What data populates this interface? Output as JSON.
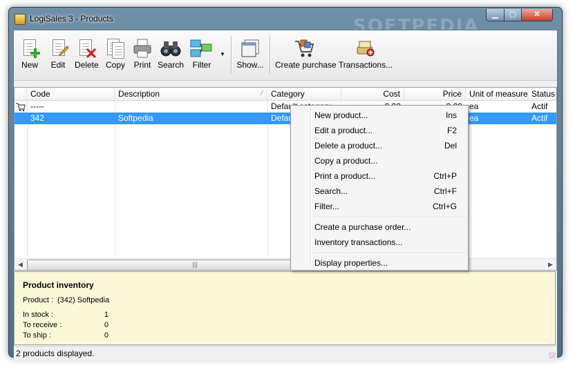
{
  "window": {
    "title": "LogiSales 3 - Products",
    "watermark": "SOFTPEDIA"
  },
  "toolbar": {
    "new": "New",
    "edit": "Edit",
    "delete": "Delete",
    "copy": "Copy",
    "print": "Print",
    "search": "Search",
    "filter": "Filter",
    "show": "Show...",
    "create_purchase": "Create purchase",
    "transactions": "Transactions..."
  },
  "grid": {
    "columns": [
      "Code",
      "Description",
      "Category",
      "Cost",
      "Price",
      "Unit of measure",
      "Status"
    ],
    "rows": [
      {
        "code": "-----",
        "description": "",
        "category": "Default category",
        "cost": "0.00",
        "price": "0.00",
        "unit": "ea",
        "status": "Actif"
      },
      {
        "code": "342",
        "description": "Softpedia",
        "category": "Defau",
        "cost": "",
        "price": "",
        "unit": "ea",
        "status": "Actif"
      }
    ]
  },
  "context_menu": {
    "items": [
      {
        "label": "New product...",
        "key": "Ins"
      },
      {
        "label": "Edit a product...",
        "key": "F2"
      },
      {
        "label": "Delete a product...",
        "key": "Del"
      },
      {
        "label": "Copy a product...",
        "key": ""
      },
      {
        "label": "Print a product...",
        "key": "Ctrl+P"
      },
      {
        "label": "Search...",
        "key": "Ctrl+F"
      },
      {
        "label": "Filter...",
        "key": "Ctrl+G"
      },
      {
        "label": "Create a purchase order...",
        "key": ""
      },
      {
        "label": "Inventory transactions...",
        "key": ""
      },
      {
        "label": "Display properties...",
        "key": ""
      }
    ]
  },
  "inventory": {
    "title": "Product inventory",
    "product_label": "Product :",
    "product_value": "(342) Softpedia",
    "in_stock_label": "In stock :",
    "in_stock_value": "1",
    "to_receive_label": "To receive :",
    "to_receive_value": "0",
    "to_ship_label": "To ship :",
    "to_ship_value": "0"
  },
  "status": {
    "text": "2 products displayed."
  },
  "colors": {
    "selection": "#3399ff",
    "inventory_bg": "#fbf8d8",
    "titlebar": "#5f7f98"
  }
}
